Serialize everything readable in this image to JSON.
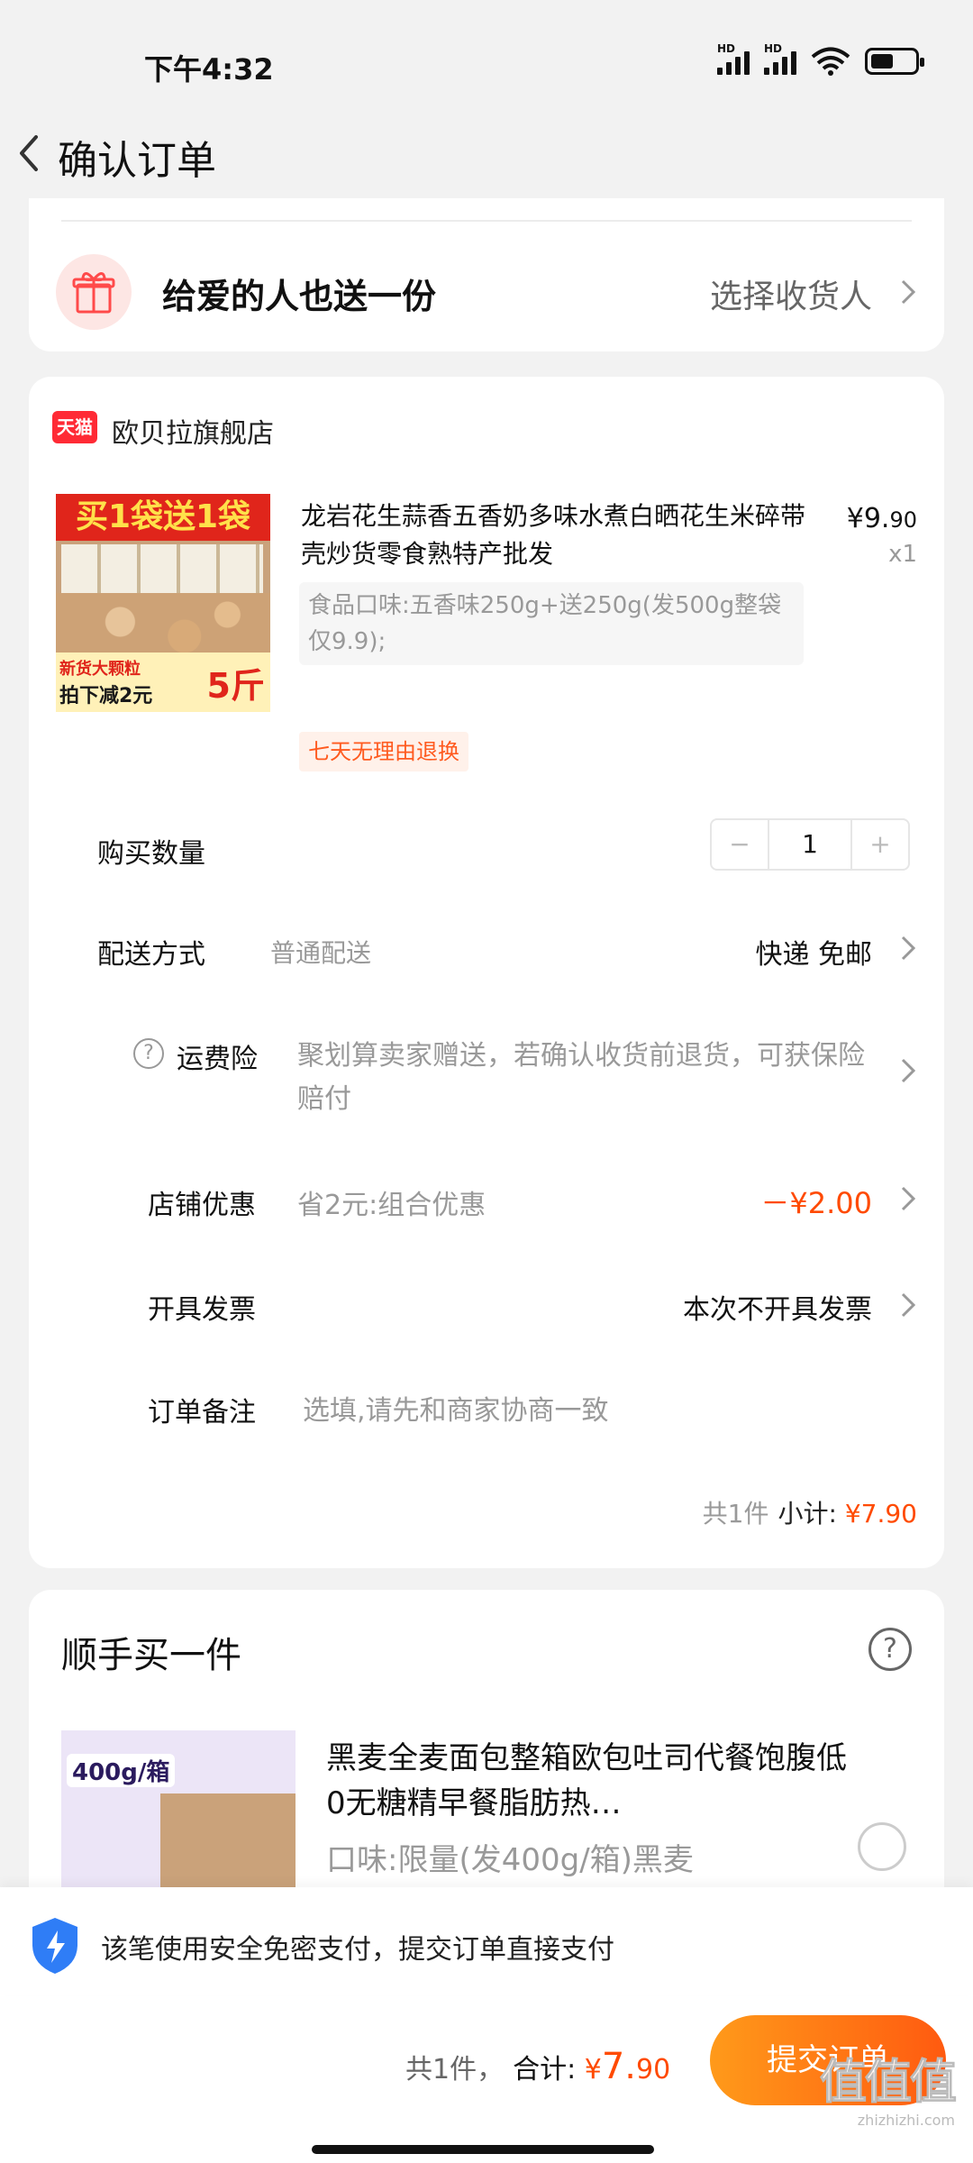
{
  "status_bar": {
    "time": "下午4:32",
    "hd1": "HD",
    "hd2": "HD"
  },
  "nav": {
    "title": "确认订单"
  },
  "gift": {
    "title": "给爱的人也送一份",
    "action": "选择收货人"
  },
  "shop": {
    "badge": "天猫",
    "name": "欧贝拉旗舰店"
  },
  "product": {
    "image_promo_top": "买1袋送1袋",
    "image_promo_line1": "新货大颗粒",
    "image_promo_line2": "拍下减2元",
    "image_promo_big": "5斤",
    "title": "龙岩花生蒜香五香奶多味水煮白晒花生米碎带壳炒货零食熟特产批发",
    "price_symbol": "¥",
    "price_int": "9.",
    "price_dec": "90",
    "qty": "x1",
    "spec": "食品口味:五香味250g+送250g(发500g整袋仅9.9);",
    "tag": "七天无理由退换"
  },
  "rows": {
    "quantity": {
      "label": "购买数量",
      "minus": "−",
      "value": "1",
      "plus": "+"
    },
    "delivery": {
      "label": "配送方式",
      "sub": "普通配送",
      "right": "快递 免邮"
    },
    "insurance": {
      "help": "?",
      "label": "运费险",
      "sub": "聚划算卖家赠送，若确认收货前退货，可获保险赔付"
    },
    "shop_discount": {
      "label": "店铺优惠",
      "sub": "省2元:组合优惠",
      "right": "－¥2.00"
    },
    "invoice": {
      "label": "开具发票",
      "right": "本次不开具发票"
    },
    "remark": {
      "label": "订单备注",
      "placeholder": "选填,请先和商家协商一致"
    }
  },
  "subtotal": {
    "count": "共1件",
    "label": "小计:",
    "amount": "¥7.90"
  },
  "recommend": {
    "title": "顺手买一件",
    "help": "?",
    "image_badge": "400g/箱",
    "name": "黑麦全麦面包整箱欧包吐司代餐饱腹低0无糖精早餐脂肪热…",
    "spec": "口味:限量(发400g/箱)黑麦"
  },
  "secure": {
    "text": "该笔使用安全免密支付，提交订单直接支付"
  },
  "footer": {
    "count": "共1件，",
    "label": "合计:",
    "symbol": "¥",
    "amount_int": "7.",
    "amount_dec": "90",
    "submit": "提交订单"
  },
  "watermark": {
    "main": "值值值",
    "site": "zhizhizhi.com"
  },
  "colors": {
    "accent": "#ff4a00",
    "button_start": "#ff9a1a",
    "button_end": "#ff5a10",
    "tmall_red": "#ff2a35"
  }
}
